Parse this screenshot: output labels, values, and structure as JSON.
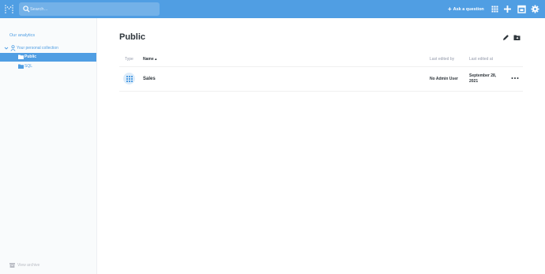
{
  "colors": {
    "brand": "#509ee3",
    "text_dark": "#2e353b",
    "text_muted": "#949aab"
  },
  "nav": {
    "logo_icon": "metabase-logo-icon",
    "search_placeholder": "Search…",
    "ask_label": "Ask a question",
    "icons": [
      "grid-icon",
      "plus-icon",
      "calendar-icon",
      "gear-icon"
    ]
  },
  "sidebar": {
    "our_analytics": "Our analytics",
    "personal_collection": "Your personal collection",
    "items": [
      {
        "label": "Public",
        "active": true
      },
      {
        "label": "SQL",
        "active": false
      }
    ],
    "view_archive": "View archive"
  },
  "main": {
    "title": "Public",
    "columns": {
      "type": "Type",
      "name": "Name",
      "last_edited_by": "Last edited by",
      "last_edited_at": "Last edited at"
    },
    "rows": [
      {
        "icon": "grid-icon",
        "name": "Sales",
        "last_edited_by": "No Admin User",
        "last_edited_at": "September 28, 2021"
      }
    ]
  }
}
